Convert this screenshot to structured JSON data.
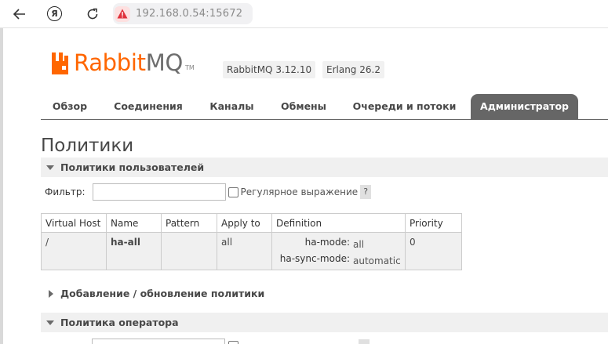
{
  "browser": {
    "url": "192.168.0.54:15672",
    "yandex_glyph": "Я",
    "icons": {
      "back": "back-arrow-icon",
      "reload": "reload-icon",
      "warning": "insecure-warning-icon"
    }
  },
  "header": {
    "logo_rabbit": "Rabbit",
    "logo_mq": "MQ",
    "logo_tm": "TM",
    "rabbitmq_version": "RabbitMQ 3.12.10",
    "erlang_version": "Erlang 26.2",
    "brand_color": "#ff6600"
  },
  "tabs": [
    {
      "label": "Обзор"
    },
    {
      "label": "Соединения"
    },
    {
      "label": "Каналы"
    },
    {
      "label": "Обмены"
    },
    {
      "label": "Очереди и потоки"
    },
    {
      "label": "Администратор",
      "active": true
    }
  ],
  "page": {
    "title": "Политики",
    "user_policies": {
      "label": "Политики пользователей",
      "filter_label": "Фильтр:",
      "filter_value": "",
      "regex_label": "Регулярное выражение",
      "help": "?"
    },
    "table": {
      "headers": [
        "Virtual Host",
        "Name",
        "Pattern",
        "Apply to",
        "Definition",
        "Priority"
      ],
      "rows": [
        {
          "vhost": "/",
          "name": "ha-all",
          "pattern": "",
          "apply_to": "all",
          "definition": [
            {
              "key": "ha-mode:",
              "value": "all"
            },
            {
              "key": "ha-sync-mode:",
              "value": "automatic"
            }
          ],
          "priority": "0"
        }
      ]
    },
    "add_policy": {
      "label": "Добавление / обновление политики"
    },
    "operator_policy": {
      "label": "Политика оператора"
    }
  }
}
